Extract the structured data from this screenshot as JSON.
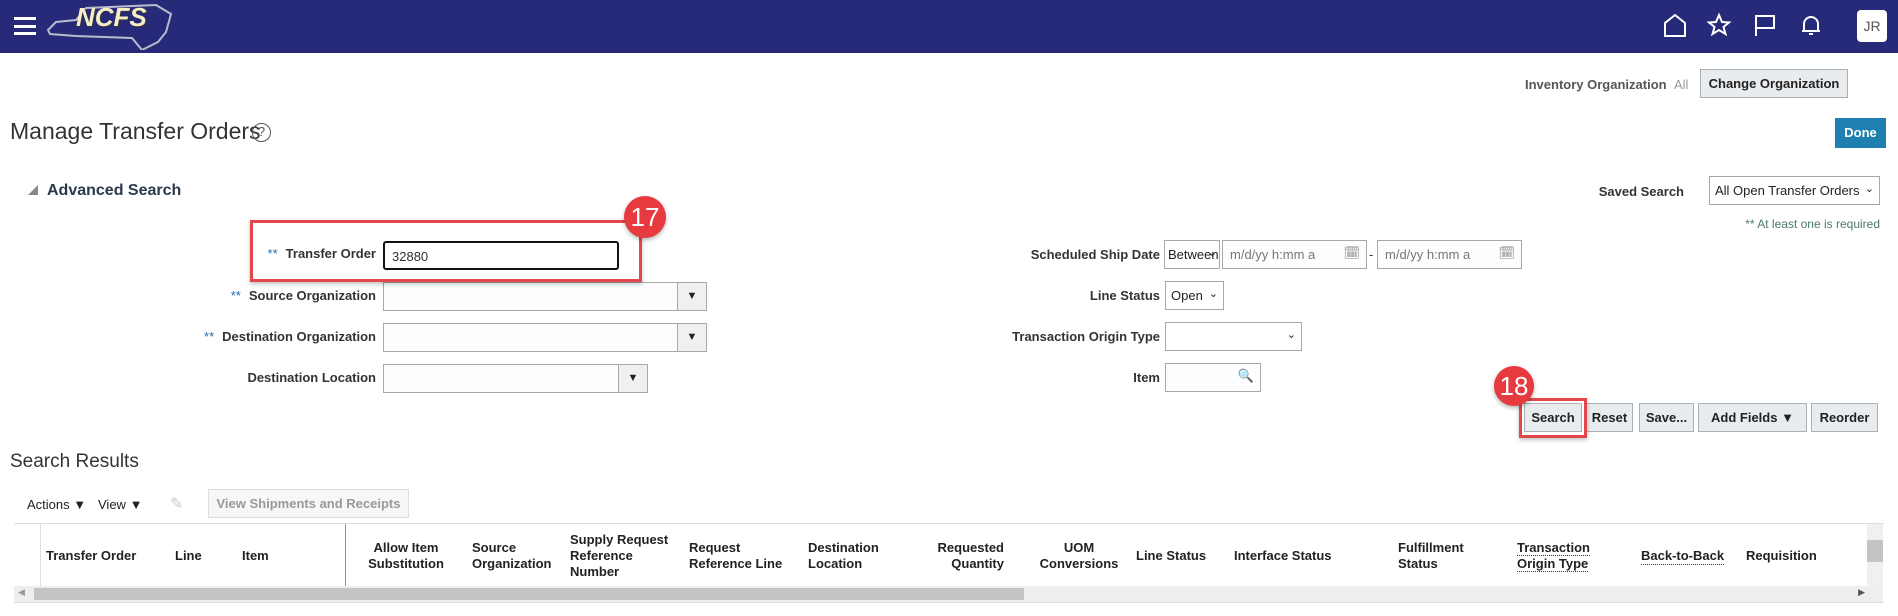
{
  "header": {
    "logo_text": "NCFS",
    "logo_subtitle": "North Carolina Financial System",
    "avatar": "JR",
    "icons": [
      "menu-icon",
      "home-icon",
      "star-icon",
      "flag-icon",
      "bell-icon"
    ]
  },
  "org": {
    "label": "Inventory Organization",
    "value": "All",
    "change_button": "Change Organization"
  },
  "page": {
    "title": "Manage Transfer Orders",
    "done": "Done"
  },
  "search": {
    "section_title": "Advanced Search",
    "saved_search_label": "Saved Search",
    "saved_search_value": "All Open Transfer Orders",
    "required_note": "** At least one is required",
    "required_mark": "**",
    "transfer_order_label": "Transfer Order",
    "transfer_order_value": "32880",
    "source_org_label": "Source Organization",
    "dest_org_label": "Destination Organization",
    "dest_location_label": "Destination Location",
    "ship_date_label": "Scheduled Ship Date",
    "ship_date_operator": "Between",
    "date_placeholder": "m/d/yy h:mm a",
    "date_sep": "-",
    "line_status_label": "Line Status",
    "line_status_value": "Open",
    "origin_type_label": "Transaction Origin Type",
    "item_label": "Item",
    "buttons": {
      "search": "Search",
      "reset": "Reset",
      "save": "Save...",
      "add_fields": "Add Fields",
      "reorder": "Reorder"
    }
  },
  "callouts": {
    "step1": "17",
    "step2": "18"
  },
  "results": {
    "title": "Search Results",
    "actions": "Actions",
    "view": "View",
    "view_shipments": "View Shipments and Receipts",
    "columns": [
      "Transfer Order",
      "Line",
      "Item",
      "Allow Item Substitution",
      "Source Organization",
      "Supply Request Reference Number",
      "Request Reference Line",
      "Destination Location",
      "Requested Quantity",
      "UOM Conversions",
      "Line Status",
      "Interface Status",
      "Fulfillment Status",
      "Transaction Origin Type",
      "Back-to-Back",
      "Requisition"
    ]
  }
}
